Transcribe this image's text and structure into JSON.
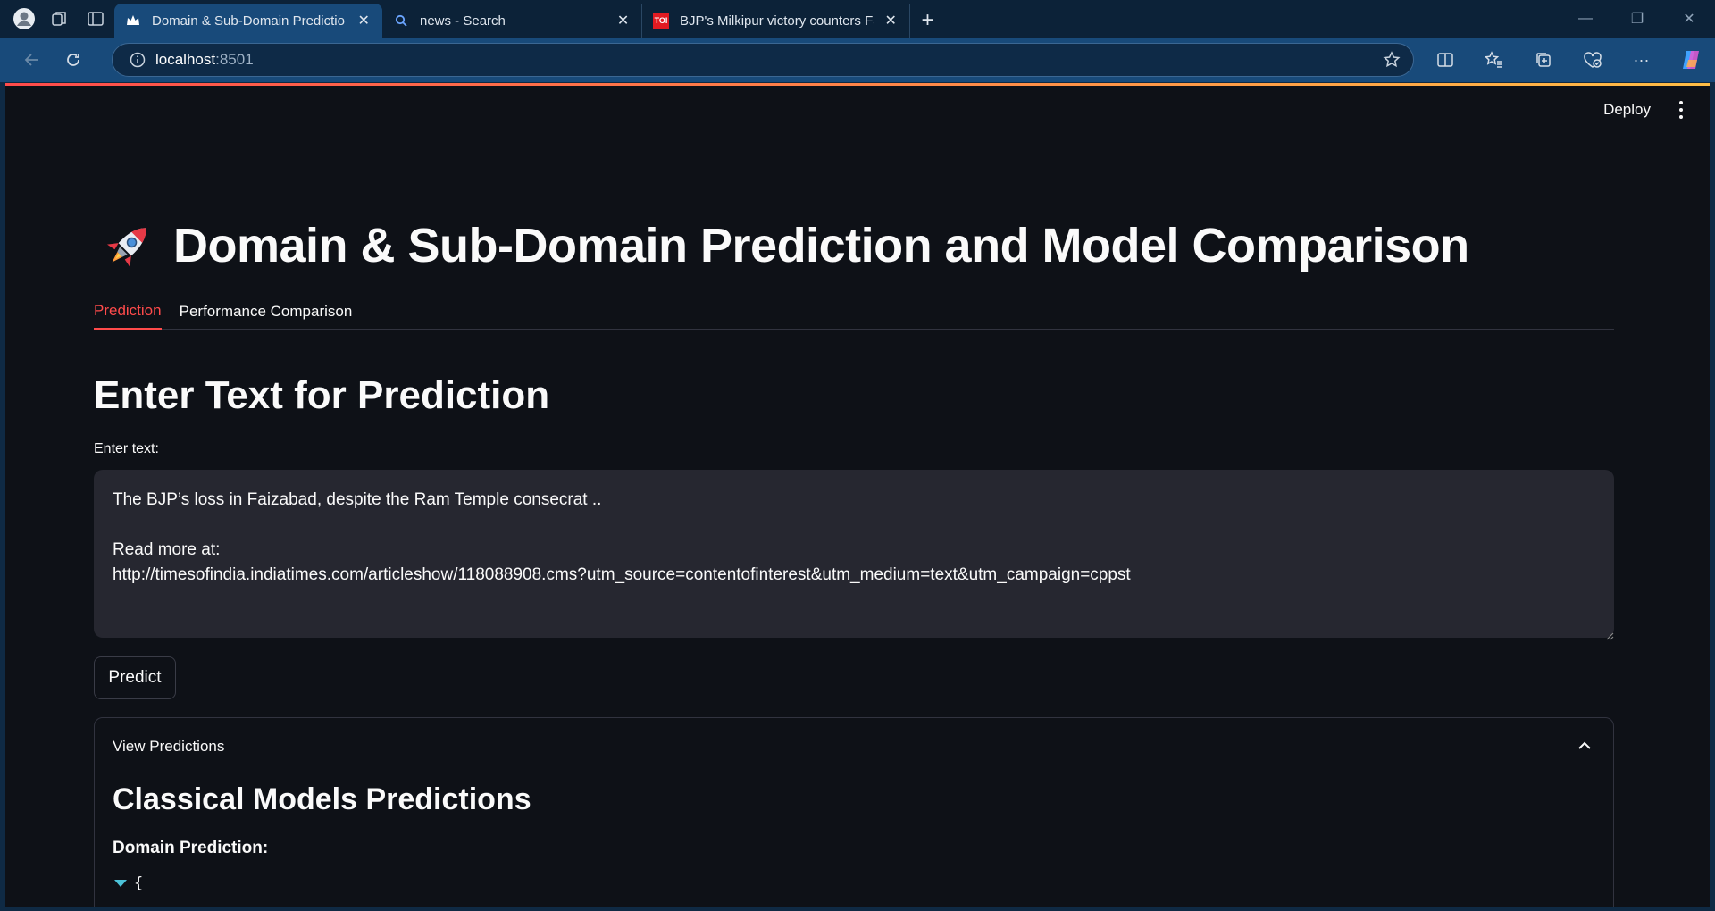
{
  "browser": {
    "tabs": [
      {
        "title": "Domain & Sub-Domain Predictio",
        "active": true,
        "favicon": "crown-icon"
      },
      {
        "title": "news - Search",
        "active": false,
        "favicon": "search-icon"
      },
      {
        "title": "BJP's Milkipur victory counters Fa",
        "active": false,
        "favicon": "toi-logo-icon"
      }
    ],
    "toi_badge": "TOI",
    "url_host": "localhost",
    "url_port": ":8501"
  },
  "app": {
    "deploy_label": "Deploy",
    "title": "Domain & Sub-Domain Prediction and Model Comparison",
    "tabs": [
      "Prediction",
      "Performance Comparison"
    ],
    "section_title": "Enter Text for Prediction",
    "input_label": "Enter text:",
    "input_value": "The BJP’s loss in Faizabad, despite the Ram Temple consecrat ..\n\nRead more at:\nhttp://timesofindia.indiatimes.com/articleshow/118088908.cms?utm_source=contentofinterest&utm_medium=text&utm_campaign=cppst",
    "predict_label": "Predict",
    "expander": {
      "header": "View Predictions",
      "title": "Classical Models Predictions",
      "subtitle": "Domain Prediction:",
      "json_open": "{"
    },
    "accent_color": "#ff4b4b"
  }
}
